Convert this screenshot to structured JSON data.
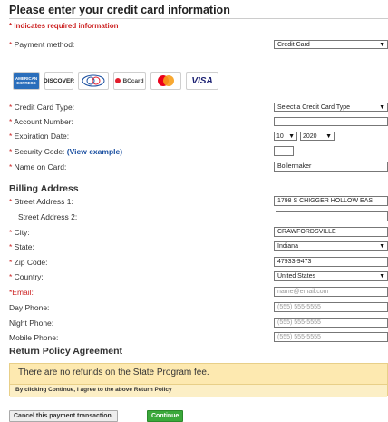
{
  "title": "Please enter your credit card information",
  "required_note": "* Indicates required information",
  "payment_method": {
    "label": "Payment method:",
    "value": "Credit Card"
  },
  "card_logos": [
    {
      "name": "American Express",
      "text": "AMERICAN EXPRESS",
      "bg": "#2a6ebb",
      "fg": "#ffffff"
    },
    {
      "name": "Discover",
      "text": "DISCOVER",
      "bg": "#ffffff",
      "fg": "#222222",
      "accent": "#f58220"
    },
    {
      "name": "Diners Club",
      "text": "Diners",
      "bg": "#ffffff",
      "fg": "#1a4fa0"
    },
    {
      "name": "BC Card",
      "text": "BCcard",
      "bg": "#ffffff",
      "fg": "#444444",
      "accent": "#e21d2c"
    },
    {
      "name": "Mastercard",
      "text": "",
      "bg": "#ffffff",
      "fg": "#222222"
    },
    {
      "name": "Visa",
      "text": "VISA",
      "bg": "#ffffff",
      "fg": "#1a1f71"
    }
  ],
  "card_fields": {
    "card_type_label": "Credit Card Type:",
    "card_type_value": "Select a Credit Card Type",
    "account_number_label": "Account Number:",
    "account_number_value": "",
    "expiration_label": "Expiration Date:",
    "exp_month": "10",
    "exp_year": "2020",
    "security_label": "Security Code:",
    "security_link": "(View example)",
    "security_value": "",
    "name_label": "Name on Card:",
    "name_value": "Boilermaker"
  },
  "billing": {
    "heading": "Billing Address",
    "street1_label": "Street Address 1:",
    "street1_value": "1798 S CHIGGER HOLLOW EAS",
    "street2_label": "Street Address 2:",
    "street2_value": "",
    "city_label": "City:",
    "city_value": "CRAWFORDSVILLE",
    "state_label": "State:",
    "state_value": "Indiana",
    "zip_label": "Zip Code:",
    "zip_value": "47933-9473",
    "country_label": "Country:",
    "country_value": "United States",
    "email_label": "*Email:",
    "email_placeholder": "name@email.com",
    "day_phone_label": "Day Phone:",
    "night_phone_label": "Night Phone:",
    "mobile_phone_label": "Mobile Phone:",
    "phone_placeholder": "(555) 555-5555"
  },
  "policy": {
    "heading": "Return Policy Agreement",
    "text": "There are no refunds on the State Program fee.",
    "agree": "By clicking Continue, I agree to the above Return Policy"
  },
  "buttons": {
    "cancel": "Cancel this payment transaction.",
    "continue": "Continue"
  },
  "colors": {
    "required": "#cc2222",
    "link": "#1a4fa0",
    "continue": "#3aa83a",
    "policy_bg": "#fde9b0"
  }
}
